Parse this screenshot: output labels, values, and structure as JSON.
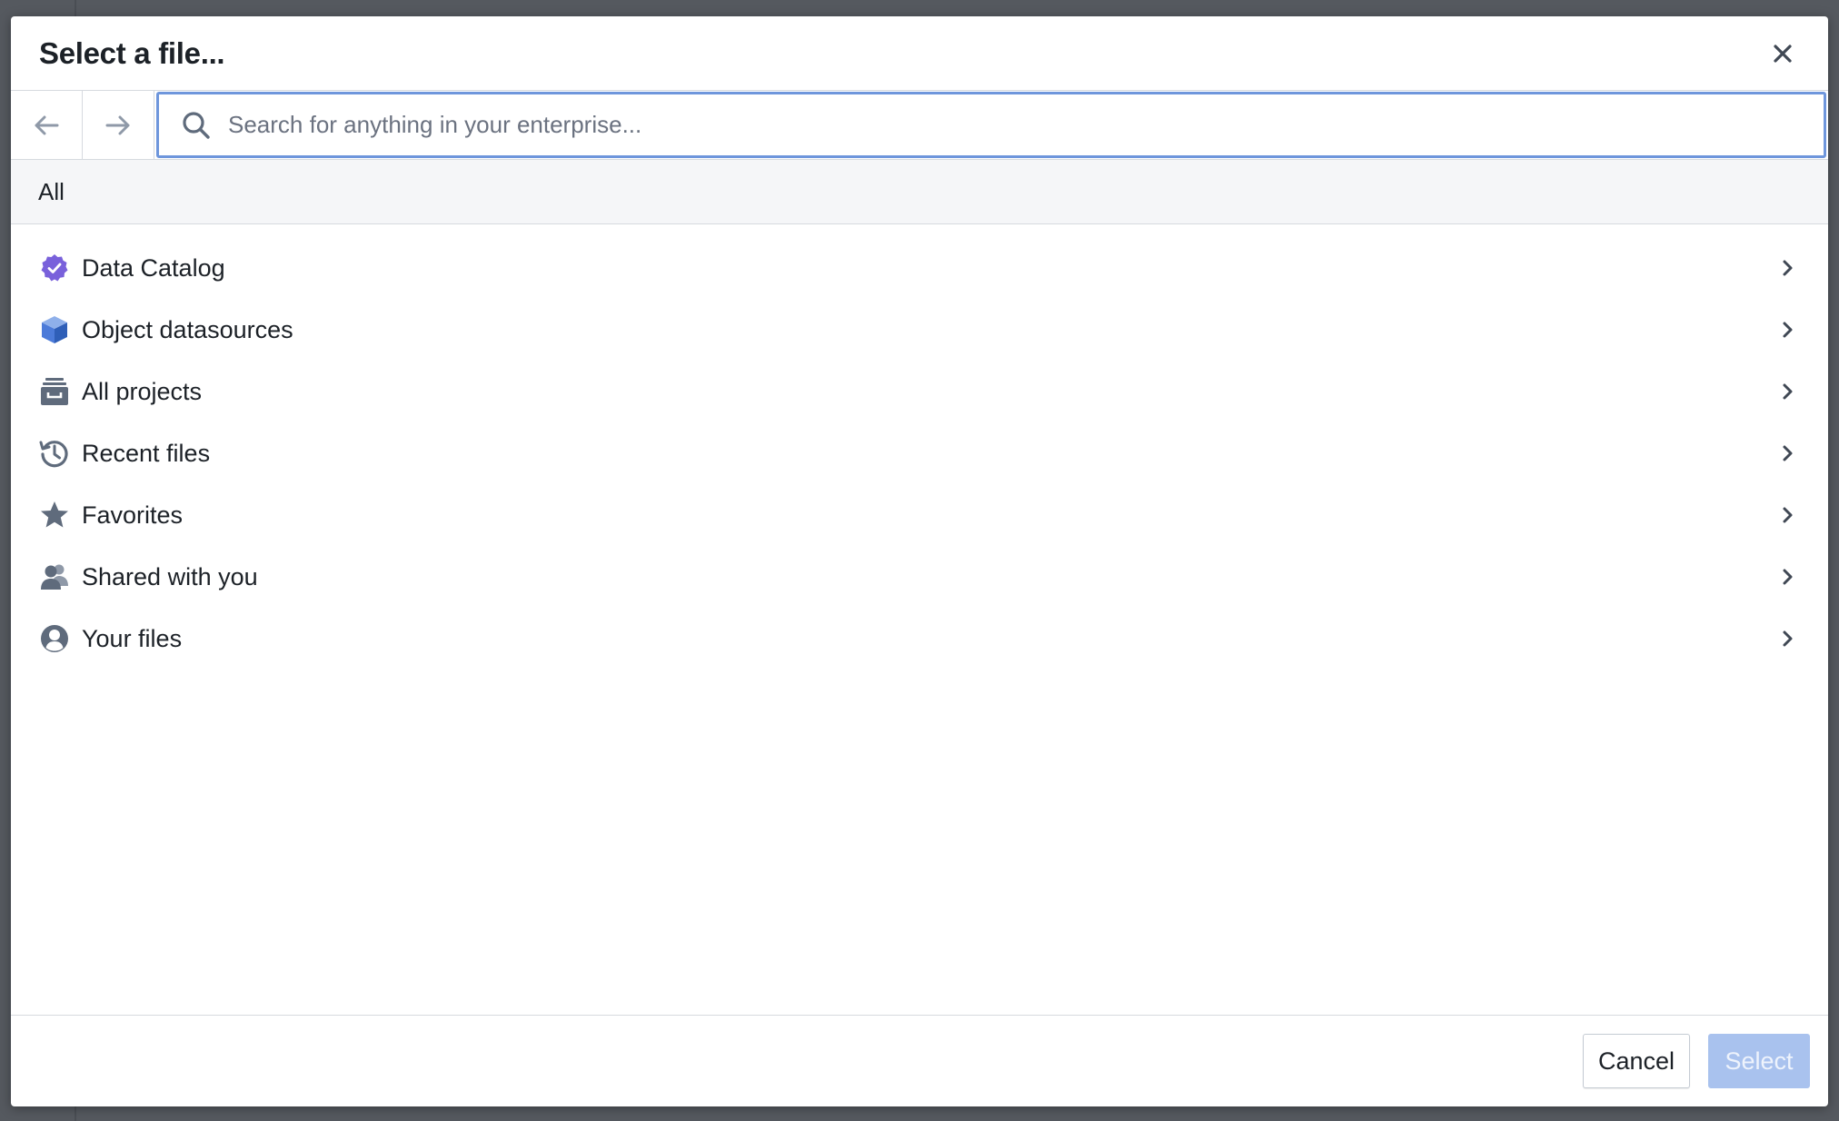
{
  "dialog": {
    "title": "Select a file..."
  },
  "search": {
    "placeholder": "Search for anything in your enterprise...",
    "value": ""
  },
  "breadcrumb": {
    "label": "All"
  },
  "items": [
    {
      "label": "Data Catalog",
      "icon": "badge-check-icon",
      "color": "#7961db"
    },
    {
      "label": "Object datasources",
      "icon": "cube-icon",
      "color": "#4c7bd9"
    },
    {
      "label": "All projects",
      "icon": "archive-box-icon",
      "color": "#5f6b7c"
    },
    {
      "label": "Recent files",
      "icon": "history-icon",
      "color": "#5f6b7c"
    },
    {
      "label": "Favorites",
      "icon": "star-icon",
      "color": "#5f6b7c"
    },
    {
      "label": "Shared with you",
      "icon": "people-icon",
      "color": "#5f6b7c"
    },
    {
      "label": "Your files",
      "icon": "user-circle-icon",
      "color": "#5f6b7c"
    }
  ],
  "footer": {
    "cancel_label": "Cancel",
    "select_label": "Select"
  },
  "colors": {
    "accent": "#6e96dc",
    "select_disabled": "#a9c2ee",
    "icon_gray": "#5f6b7c"
  }
}
